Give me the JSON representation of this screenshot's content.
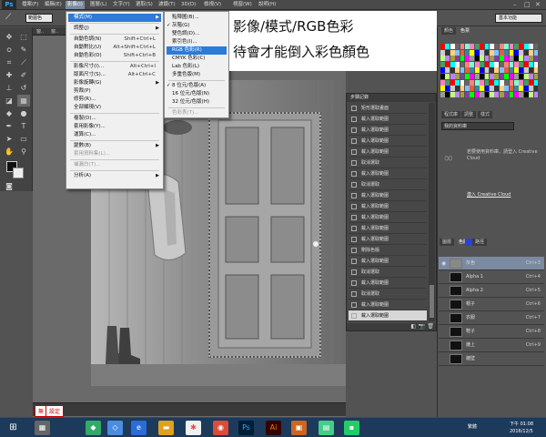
{
  "app": {
    "logo": "Ps",
    "menus": [
      "檔案(F)",
      "編輯(E)",
      "影像(I)",
      "圖層(L)",
      "文字(Y)",
      "選取(S)",
      "濾鏡(T)",
      "3D(D)",
      "檢視(V)",
      "視窗(W)",
      "說明(H)"
    ],
    "active_menu_index": 2
  },
  "options_bar": {
    "tool_preset": "範圍色",
    "workspace": "基本功能"
  },
  "doc_tabs": [
    "窗..",
    "窗..",
    "窗..",
    "窗..",
    "窗.."
  ],
  "image_menu": {
    "items": [
      {
        "label": "模式(M)",
        "shortcut": "",
        "has_sub": true,
        "selected": true
      },
      {
        "sep": true
      },
      {
        "label": "調整(J)",
        "shortcut": "",
        "has_sub": true
      },
      {
        "sep": true
      },
      {
        "label": "自動色調(N)",
        "shortcut": "Shift+Ctrl+L"
      },
      {
        "label": "自動對比(U)",
        "shortcut": "Alt+Shift+Ctrl+L"
      },
      {
        "label": "自動色彩(O)",
        "shortcut": "Shift+Ctrl+B"
      },
      {
        "sep": true
      },
      {
        "label": "影像尺寸(I)...",
        "shortcut": "Alt+Ctrl+I"
      },
      {
        "label": "版面尺寸(S)...",
        "shortcut": "Alt+Ctrl+C"
      },
      {
        "label": "影像旋轉(G)",
        "shortcut": "",
        "has_sub": true
      },
      {
        "label": "剪裁(P)",
        "shortcut": ""
      },
      {
        "label": "修剪(R)...",
        "shortcut": ""
      },
      {
        "label": "全部顯現(V)",
        "shortcut": ""
      },
      {
        "sep": true
      },
      {
        "label": "複製(D)...",
        "shortcut": ""
      },
      {
        "label": "套用影像(Y)...",
        "shortcut": ""
      },
      {
        "label": "運算(C)...",
        "shortcut": ""
      },
      {
        "sep": true
      },
      {
        "label": "變數(B)",
        "shortcut": "",
        "has_sub": true
      },
      {
        "label": "套用資料集(L)...",
        "shortcut": "",
        "dim": true
      },
      {
        "sep": true
      },
      {
        "label": "補漏白(T)...",
        "shortcut": "",
        "dim": true
      },
      {
        "sep": true
      },
      {
        "label": "分析(A)",
        "shortcut": "",
        "has_sub": true
      }
    ]
  },
  "mode_submenu": {
    "items": [
      {
        "label": "點陣圖(B)..."
      },
      {
        "label": "灰階(G)",
        "checked": true
      },
      {
        "label": "雙色調(D)..."
      },
      {
        "label": "索引色(I)..."
      },
      {
        "label": "RGB 色彩(R)",
        "selected": true
      },
      {
        "label": "CMYK 色彩(C)"
      },
      {
        "label": "Lab 色彩(L)"
      },
      {
        "label": "多重色版(M)"
      },
      {
        "sep": true
      },
      {
        "label": "8 位元/色版(A)",
        "checked": true
      },
      {
        "label": "16 位元/色版(N)"
      },
      {
        "label": "32 位元/色版(H)"
      },
      {
        "sep": true
      },
      {
        "label": "色彩表(T)...",
        "dim": true
      }
    ]
  },
  "caption": {
    "line1": "影像/模式/RGB色彩",
    "line2": "待會才能倒入彩色顏色"
  },
  "history_panel": {
    "title": "步驟記錄",
    "rows": [
      "矩形選取畫面",
      "載入選取範圍",
      "載入選取範圍",
      "載入選取範圍",
      "載入選取範圍",
      "取消選取",
      "載入選取範圍",
      "取消選取",
      "載入選取範圍",
      "載入選取範圍",
      "載入選取範圍",
      "載入選取範圍",
      "載入選取範圍",
      "刪除色版",
      "載入選取範圍",
      "取消選取",
      "載入選取範圍",
      "取消選取",
      "載入選取範圍",
      "載入選取範圍"
    ],
    "selected_index": 19
  },
  "right_panels": {
    "tab1": "顏色",
    "tab2": "色票",
    "lib_tab1": "程式庫",
    "lib_tab2": "調整",
    "lib_tab3": "樣式",
    "library_select": "我的資料庫",
    "cc_message": "若要使用資料庫，請登入 Creative Cloud",
    "cc_link": "連入 Creative Cloud",
    "bottom_tabs": [
      "圖層",
      "色版",
      "路徑"
    ]
  },
  "channels": [
    {
      "name": "灰色",
      "shortcut": "Ctrl+3",
      "selected": true,
      "visible": true
    },
    {
      "name": "Alpha 1",
      "shortcut": "Ctrl+4"
    },
    {
      "name": "Alpha 2",
      "shortcut": "Ctrl+5"
    },
    {
      "name": "帽子",
      "shortcut": "Ctrl+6"
    },
    {
      "name": "衣服",
      "shortcut": "Ctrl+7"
    },
    {
      "name": "鞋子",
      "shortcut": "Ctrl+8"
    },
    {
      "name": "牆上",
      "shortcut": "Ctrl+9"
    },
    {
      "name": "牆壁",
      "shortcut": ""
    }
  ],
  "status": {
    "zoom": "無",
    "watermark": "設定"
  },
  "taskbar": {
    "time": "下午 01:08",
    "date": "2016/12/5",
    "ime": "繁體",
    "ai_label": "Ai",
    "ps_label": "Ps"
  },
  "colors": {
    "accent": "#2c7bd6",
    "ps_blue": "#31a8ff",
    "ai_orange": "#ff7c00",
    "taskbar": "#1d3a5a"
  }
}
